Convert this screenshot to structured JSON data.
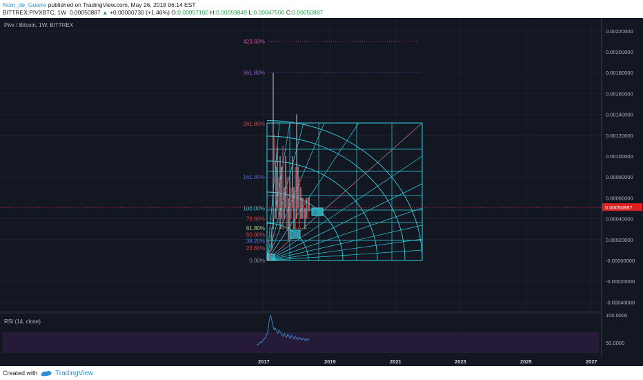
{
  "header": {
    "author": "Nom_de_Guerre",
    "published_text": "published on TradingView.com, May 26, 2018 06:14 EST",
    "symbol": "BITTREX:PIVXBTC, 1W",
    "last_price": "0.00050887",
    "change_icon": "up-triangle-icon",
    "change": "+0.00000730 (+1.46%)",
    "open_label": "O:",
    "open": "0.00057100",
    "high_label": "H:",
    "high": "0.00059849",
    "low_label": "L:",
    "low": "0.00047500",
    "close_label": "C:",
    "close": "0.00050887"
  },
  "chart": {
    "title": "Pivx / Bitcoin, 1W, BITTREX",
    "price_axis_ticks": [
      "0.00220000",
      "0.00200000",
      "0.00180000",
      "0.00160000",
      "0.00140000",
      "0.00120000",
      "0.00100000",
      "0.00080000",
      "0.00060000",
      "0.00040000",
      "0.00020000",
      "-0.00000000",
      "-0.00020000",
      "-0.00040000"
    ],
    "last_price_label": "0.00050887",
    "fib_levels": [
      {
        "label": "423.60%",
        "value": 0.0021,
        "color": "#e040a0"
      },
      {
        "label": "361.80%",
        "value": 0.0018,
        "color": "#9d4dd6"
      },
      {
        "label": "261.80%",
        "value": 0.00131,
        "color": "#e03b3b"
      },
      {
        "label": "161.80%",
        "value": 0.0008,
        "color": "#4b5bd6"
      },
      {
        "label": "100.00%",
        "value": 0.0005,
        "color": "#33c3d6"
      },
      {
        "label": "78.60%",
        "value": 0.0004,
        "color": "#d83a3a"
      },
      {
        "label": "61.80%",
        "value": 0.00031,
        "color": "#a9d36b"
      },
      {
        "label": "50.00%",
        "value": 0.00025,
        "color": "#e03b3b"
      },
      {
        "label": "38.20%",
        "value": 0.00019,
        "color": "#4c7bd6"
      },
      {
        "label": "23.60%",
        "value": 0.00012,
        "color": "#e03b3b"
      },
      {
        "label": "0.00%",
        "value": 0.0,
        "color": "#8a8a8a"
      }
    ],
    "colors": {
      "background": "#131722",
      "grid": "#262a36",
      "gann": "#31d0e0",
      "price_line": "#ff2b2b",
      "rsi": "#3b8fd4",
      "rsi_band": "#2a1b3d"
    }
  },
  "rsi": {
    "label": "RSI (14, close)",
    "ticks": [
      "100.0000",
      "50.0000"
    ]
  },
  "time_axis": [
    "2017",
    "2019",
    "2021",
    "2023",
    "2025",
    "2027"
  ],
  "footer": {
    "created_with": "Created with",
    "brand": "TradingView",
    "logo_icon": "tradingview-logo-icon"
  }
}
